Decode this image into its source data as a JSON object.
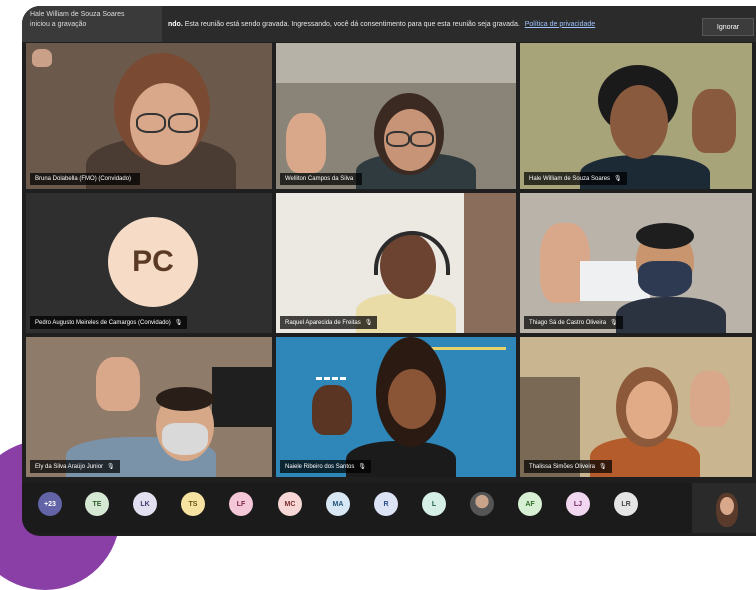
{
  "banner": {
    "presenter_line1": "Hale William de Souza Soares",
    "presenter_line2": "iniciou a gravação",
    "message_bold": "ndo.",
    "message": "Esta reunião está sendo gravada. Ingressando, você dá consentimento para que esta reunião seja gravada.",
    "privacy_link": "Política de privacidade",
    "ignore_button": "Ignorar"
  },
  "tiles": [
    {
      "name": "Bruna Dolabella (FMO) (Convidado)",
      "mic": "",
      "bg": "#6b5a4b"
    },
    {
      "name": "Welliton Campos da Silva",
      "mic": "",
      "bg": "#8a8478"
    },
    {
      "name": "Hale William de Souza Soares",
      "mic": "🎙",
      "bg": "#a8a47a"
    },
    {
      "name": "Pedro Augusto Meireles de Camargos (Convidado)",
      "mic": "🎙",
      "bg": "#2f2f2f",
      "initials": "PC"
    },
    {
      "name": "Raquel Aparecida de Freitas",
      "mic": "🎙",
      "bg": "#ece8e2"
    },
    {
      "name": "Thiago Sá de Castro Oliveira",
      "mic": "🎙",
      "bg": "#b9b3a9"
    },
    {
      "name": "Ely da Silva Araújo Junior",
      "mic": "🎙",
      "bg": "#8e7b6a"
    },
    {
      "name": "Naiele Ribeiro dos Santos",
      "mic": "🎙",
      "bg": "#2e87b8"
    },
    {
      "name": "Thalissa Simões Oliveira",
      "mic": "🎙",
      "bg": "#c9b58f"
    }
  ],
  "participants": [
    {
      "initials": "+23",
      "bg": "#6264a7",
      "fg": "#ffffff"
    },
    {
      "initials": "TE",
      "bg": "#d5e8d4",
      "fg": "#2f5e2e"
    },
    {
      "initials": "LK",
      "bg": "#e1dff0",
      "fg": "#3c3a6b"
    },
    {
      "initials": "TS",
      "bg": "#f7e3a1",
      "fg": "#6b5412"
    },
    {
      "initials": "LF",
      "bg": "#f3c7d8",
      "fg": "#7a2448"
    },
    {
      "initials": "MC",
      "bg": "#f7d6d6",
      "fg": "#7c2f2f"
    },
    {
      "initials": "MA",
      "bg": "#d7e7f4",
      "fg": "#24557a"
    },
    {
      "initials": "R",
      "bg": "#dbe3f5",
      "fg": "#2e4a8a"
    },
    {
      "initials": "L",
      "bg": "#d6efe6",
      "fg": "#1f5c46"
    },
    {
      "initials": "",
      "bg": "#888888",
      "fg": "#ffffff"
    },
    {
      "initials": "AF",
      "bg": "#d7f0d3",
      "fg": "#2e6b29"
    },
    {
      "initials": "LJ",
      "bg": "#f1d7ef",
      "fg": "#6e2a66"
    },
    {
      "initials": "LR",
      "bg": "#e5e5e5",
      "fg": "#444444"
    }
  ]
}
